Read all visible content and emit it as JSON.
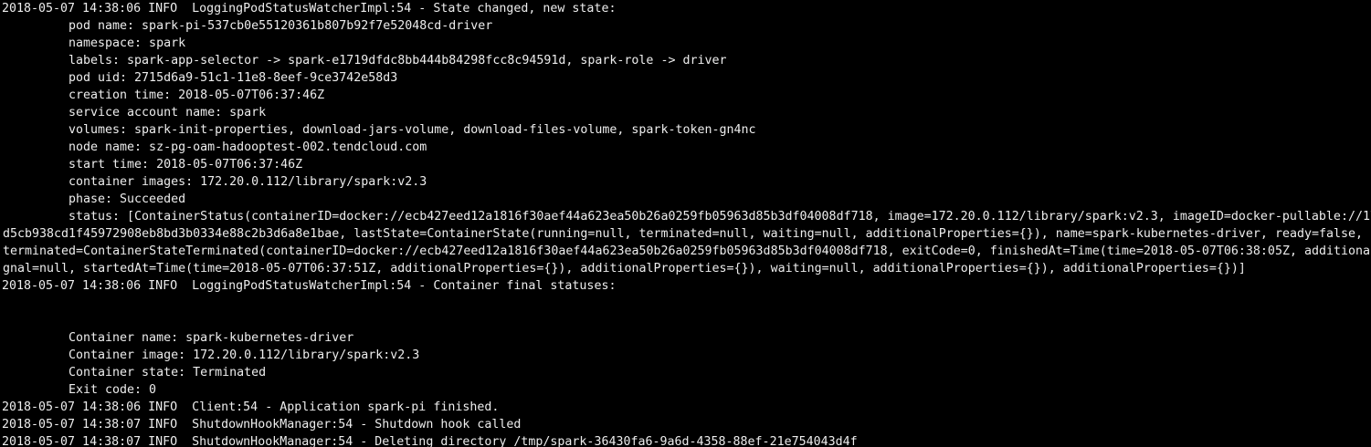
{
  "colors": {
    "background": "#000000",
    "text": "#ededed"
  },
  "terminal": {
    "lines": [
      "2018-05-07 14:38:06 INFO  LoggingPodStatusWatcherImpl:54 - State changed, new state:",
      "pod name: spark-pi-537cb0e55120361b807b92f7e52048cd-driver",
      "namespace: spark",
      "labels: spark-app-selector -> spark-e1719dfdc8bb444b84298fcc8c94591d, spark-role -> driver",
      "pod uid: 2715d6a9-51c1-11e8-8eef-9ce3742e58d3",
      "creation time: 2018-05-07T06:37:46Z",
      "service account name: spark",
      "volumes: spark-init-properties, download-jars-volume, download-files-volume, spark-token-gn4nc",
      "node name: sz-pg-oam-hadooptest-002.tendcloud.com",
      "start time: 2018-05-07T06:37:46Z",
      "container images: 172.20.0.112/library/spark:v2.3",
      "phase: Succeeded",
      "status: [ContainerStatus(containerID=docker://ecb427eed12a1816f30aef44a623ea50b26a0259fb05963d85b3df04008df718, image=172.20.0.112/library/spark:v2.3, imageID=docker-pullable://17",
      "d5cb938cd1f45972908eb8bd3b0334e88c2b3d6a8e1bae, lastState=ContainerState(running=null, terminated=null, waiting=null, additionalProperties={}), name=spark-kubernetes-driver, ready=false, r",
      "terminated=ContainerStateTerminated(containerID=docker://ecb427eed12a1816f30aef44a623ea50b26a0259fb05963d85b3df04008df718, exitCode=0, finishedAt=Time(time=2018-05-07T06:38:05Z, additional",
      "gnal=null, startedAt=Time(time=2018-05-07T06:37:51Z, additionalProperties={}), additionalProperties={}), waiting=null, additionalProperties={}), additionalProperties={})]",
      "2018-05-07 14:38:06 INFO  LoggingPodStatusWatcherImpl:54 - Container final statuses:",
      "",
      "",
      "Container name: spark-kubernetes-driver",
      "Container image: 172.20.0.112/library/spark:v2.3",
      "Container state: Terminated",
      "Exit code: 0",
      "2018-05-07 14:38:06 INFO  Client:54 - Application spark-pi finished.",
      "2018-05-07 14:38:07 INFO  ShutdownHookManager:54 - Shutdown hook called",
      "2018-05-07 14:38:07 INFO  ShutdownHookManager:54 - Deleting directory /tmp/spark-36430fa6-9a6d-4358-88ef-21e754043d4f"
    ]
  }
}
